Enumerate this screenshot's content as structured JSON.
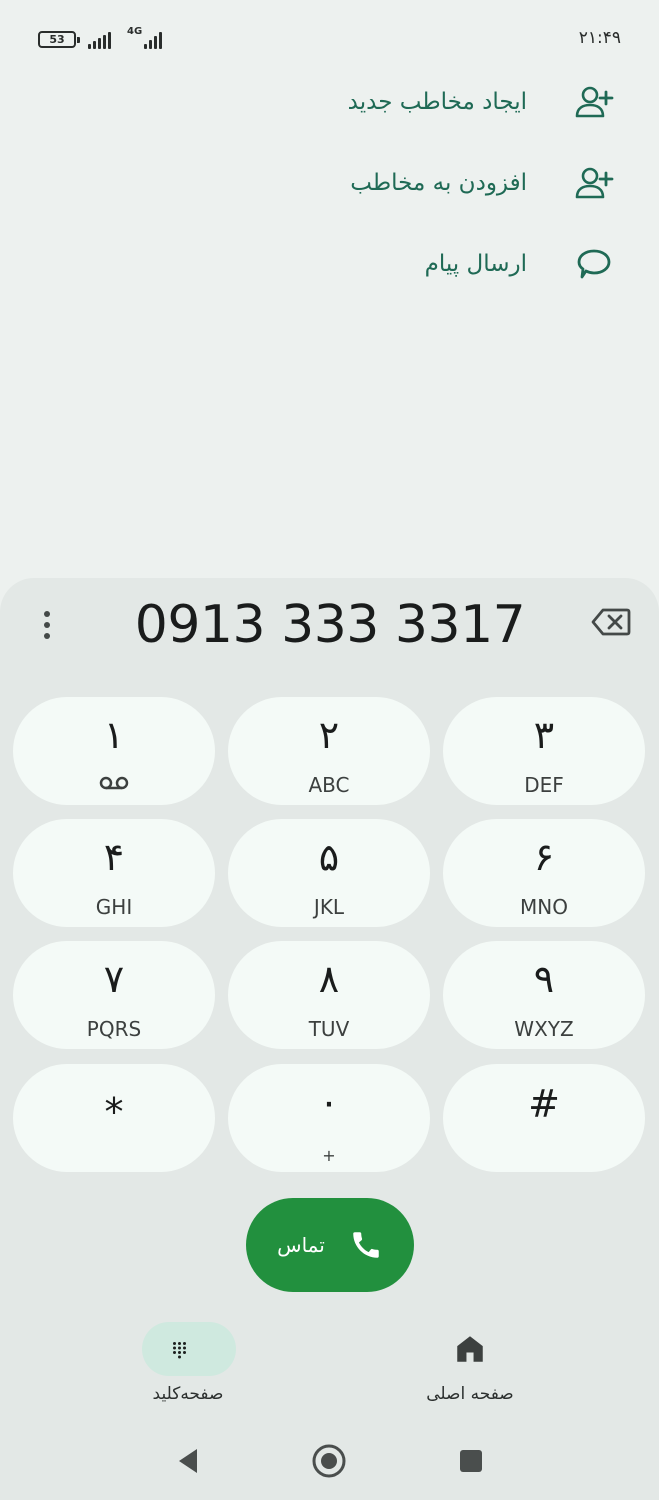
{
  "status_bar": {
    "battery": "53",
    "network_type": "4G",
    "time": "۲۱:۴۹"
  },
  "actions": [
    {
      "label": "ایجاد مخاطب جدید",
      "icon": "person-add-icon"
    },
    {
      "label": "افزودن به مخاطب",
      "icon": "person-add-icon"
    },
    {
      "label": "ارسال پیام",
      "icon": "message-bubble-icon"
    }
  ],
  "dialer": {
    "number": "0913 333 3317",
    "keys": [
      {
        "digit": "۱",
        "letters": ""
      },
      {
        "digit": "۲",
        "letters": "ABC"
      },
      {
        "digit": "۳",
        "letters": "DEF"
      },
      {
        "digit": "۴",
        "letters": "GHI"
      },
      {
        "digit": "۵",
        "letters": "JKL"
      },
      {
        "digit": "۶",
        "letters": "MNO"
      },
      {
        "digit": "۷",
        "letters": "PQRS"
      },
      {
        "digit": "۸",
        "letters": "TUV"
      },
      {
        "digit": "۹",
        "letters": "WXYZ"
      },
      {
        "digit": "*",
        "letters": ""
      },
      {
        "digit": "۰",
        "letters": "+"
      },
      {
        "digit": "#",
        "letters": ""
      }
    ],
    "call_label": "تماس"
  },
  "bottom_nav": {
    "keypad_label": "صفحه‌کلید",
    "home_label": "صفحه اصلی"
  },
  "colors": {
    "accent_text": "#1f6a55",
    "call_green": "#22903e",
    "key_bg": "#f4faf7",
    "sheet_bg": "#e3e8e6",
    "active_nav_pill": "#cfe9df"
  }
}
